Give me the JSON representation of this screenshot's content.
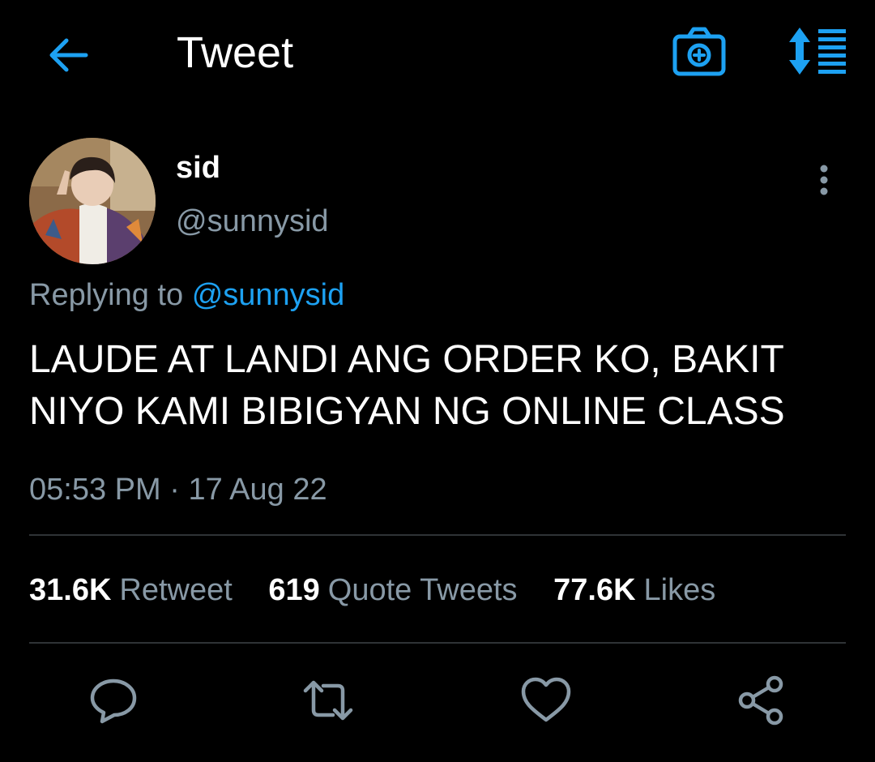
{
  "header": {
    "title": "Tweet",
    "back_icon": "arrow-left-icon",
    "camera_icon": "camera-add-icon",
    "sort_icon": "sort-list-icon"
  },
  "user": {
    "display_name": "sid",
    "handle": "@sunnysid"
  },
  "tweet": {
    "replying_prefix": "Replying to",
    "replying_handle": "@sunnysid",
    "text": "LAUDE AT LANDI ANG ORDER KO, BAKIT\nNIYO KAMI BIBIGYAN NG ONLINE CLASS",
    "time": "05:53 PM",
    "separator": "·",
    "date": "17 Aug 22"
  },
  "stats": [
    {
      "count": "31.6K",
      "label": "Retweet"
    },
    {
      "count": "619",
      "label": "Quote Tweets"
    },
    {
      "count": "77.6K",
      "label": "Likes"
    }
  ],
  "actions": [
    "reply-icon",
    "retweet-icon",
    "like-icon",
    "share-icon"
  ],
  "colors": {
    "background": "#000000",
    "accent": "#1da1f2",
    "muted": "#8899a6",
    "divider": "#2f3336",
    "icon": "#8899a6"
  }
}
